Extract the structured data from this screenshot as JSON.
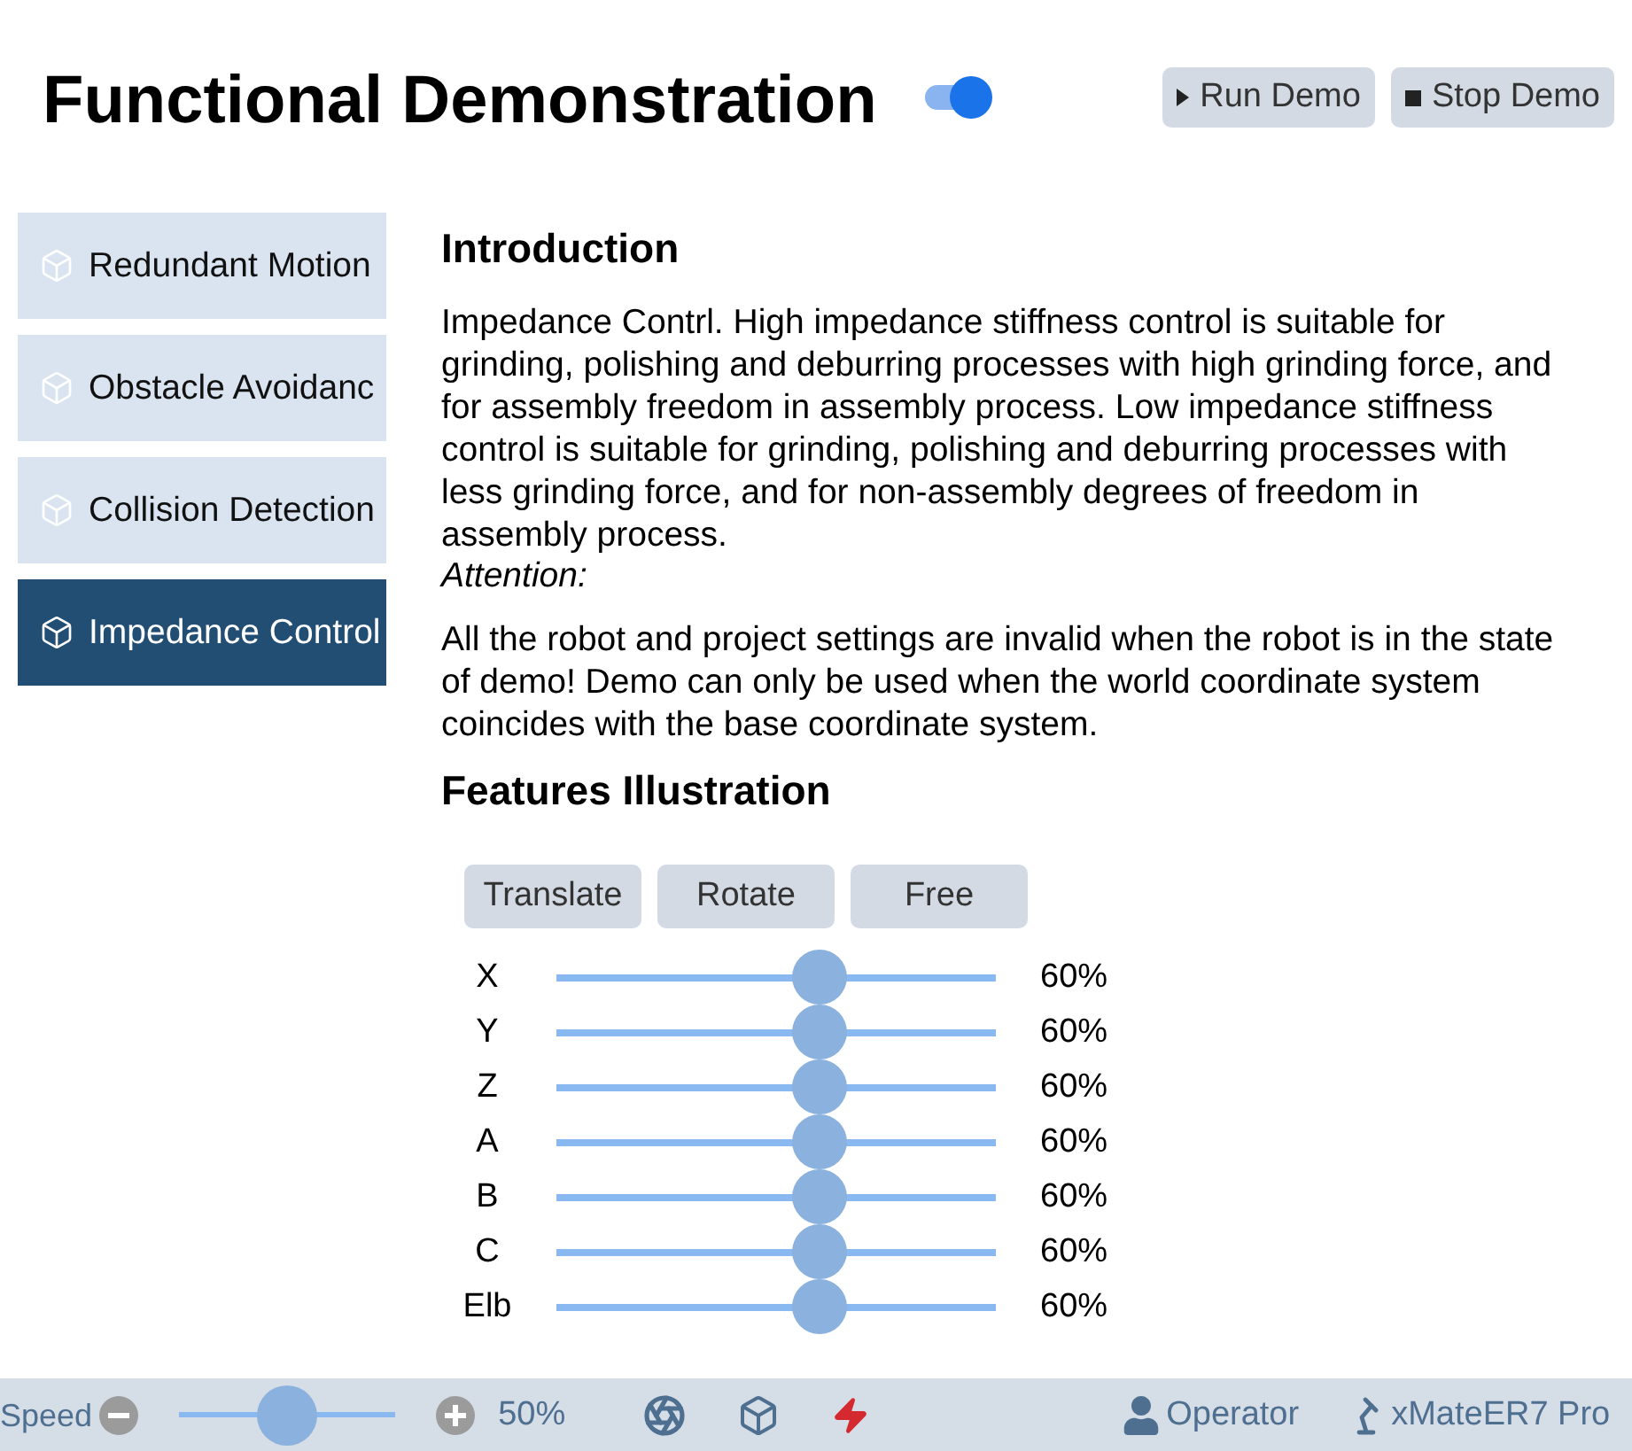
{
  "header": {
    "title": "Functional Demonstration",
    "toggle": {
      "on": true
    },
    "buttons": [
      {
        "kind": "play",
        "label": "Run Demo"
      },
      {
        "kind": "stop",
        "label": "Stop Demo"
      }
    ]
  },
  "sidebar": {
    "items": [
      {
        "label": "Redundant Motion",
        "selected": false
      },
      {
        "label": "Obstacle Avoidanc",
        "selected": false
      },
      {
        "label": "Collision Detection",
        "selected": false
      },
      {
        "label": "Impedance Control",
        "selected": true
      }
    ]
  },
  "content": {
    "introduction": {
      "heading": "Introduction",
      "text": "Impedance Contrl. High impedance stiffness control is suitable for grinding, polishing and deburring processes with high grinding force, and for assembly freedom in assembly process. Low impedance stiffness control is suitable for grinding, polishing and deburring processes with less grinding force, and for non-assembly degrees of freedom in assembly process.",
      "attention_label": "Attention:",
      "attention_text": "All the robot and project settings are invalid when the robot is in the state of demo! Demo can only be used when the world coordinate system coincides with the base coordinate system."
    },
    "features": {
      "heading": "Features Illustration",
      "modes": [
        {
          "label": "Translate",
          "selected": false
        },
        {
          "label": "Rotate",
          "selected": false
        },
        {
          "label": "Free",
          "selected": false
        }
      ],
      "axes": [
        {
          "name": "X",
          "level": 0.6,
          "reading": "60%"
        },
        {
          "name": "Y",
          "level": 0.6,
          "reading": "60%"
        },
        {
          "name": "Z",
          "level": 0.6,
          "reading": "60%"
        },
        {
          "name": "A",
          "level": 0.6,
          "reading": "60%"
        },
        {
          "name": "B",
          "level": 0.6,
          "reading": "60%"
        },
        {
          "name": "C",
          "level": 0.6,
          "reading": "60%"
        },
        {
          "name": "Elb",
          "level": 0.6,
          "reading": "60%"
        }
      ]
    }
  },
  "status_bar": {
    "speed": {
      "label": "Speed",
      "level": 0.5,
      "reading": "50%"
    },
    "user": "Operator",
    "robot": "xMateER7 Pro"
  }
}
